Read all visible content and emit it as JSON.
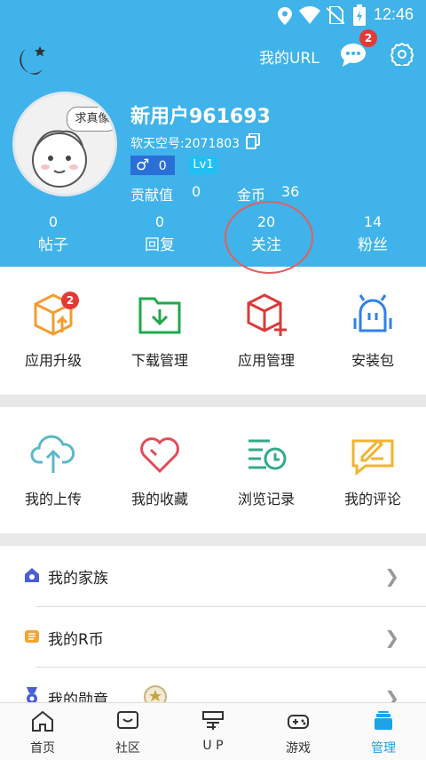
{
  "status": {
    "time": "12:46"
  },
  "topbar": {
    "url_label": "我的URL",
    "message_badge": "2"
  },
  "profile": {
    "avatar_text": "求真像",
    "username": "新用户961693",
    "account": "软天空号:2071803",
    "gender_count": "0",
    "level": "Lv1",
    "contribution_label": "贡献值",
    "contribution_value": "0",
    "coins_label": "金币",
    "coins_value": "36"
  },
  "counts": [
    {
      "num": "0",
      "label": "帖子"
    },
    {
      "num": "0",
      "label": "回复"
    },
    {
      "num": "20",
      "label": "关注"
    },
    {
      "num": "14",
      "label": "粉丝"
    }
  ],
  "grid1": [
    {
      "label": "应用升级",
      "badge": "2"
    },
    {
      "label": "下载管理"
    },
    {
      "label": "应用管理"
    },
    {
      "label": "安装包"
    }
  ],
  "grid2": [
    {
      "label": "我的上传"
    },
    {
      "label": "我的收藏"
    },
    {
      "label": "浏览记录"
    },
    {
      "label": "我的评论"
    }
  ],
  "list": [
    {
      "label": "我的家族"
    },
    {
      "label": "我的R币"
    },
    {
      "label": "我的勋章"
    }
  ],
  "bottom_nav": [
    {
      "label": "首页"
    },
    {
      "label": "社区"
    },
    {
      "label": "U P"
    },
    {
      "label": "游戏"
    },
    {
      "label": "管理"
    }
  ],
  "colors": {
    "header": "#3fb3ea",
    "active": "#1ea3e6"
  }
}
